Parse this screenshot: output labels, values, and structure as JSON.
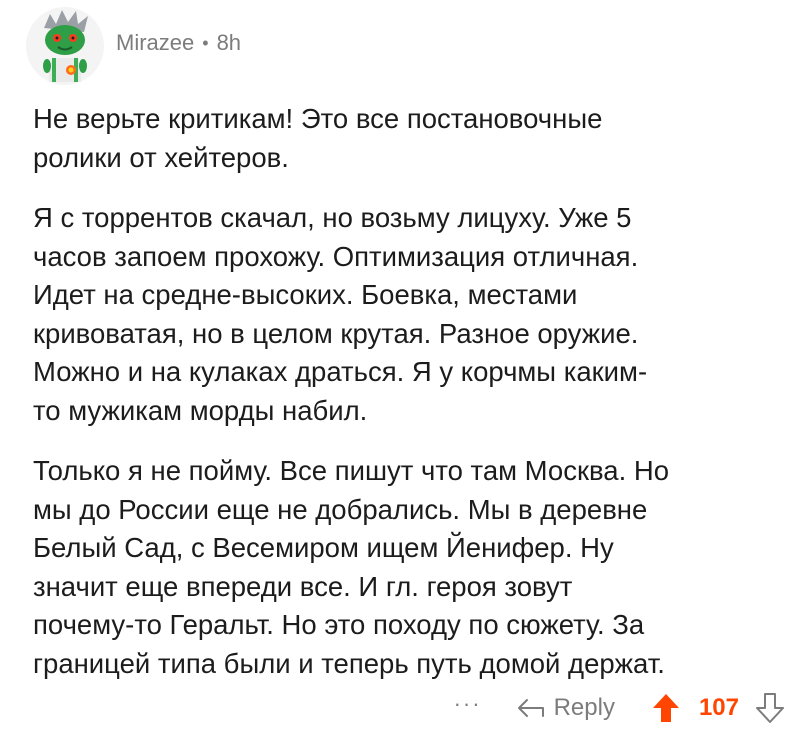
{
  "comment": {
    "author": "Mirazee",
    "separator": "•",
    "age": "8h",
    "paragraphs": [
      "Не верьте критикам! Это все постановочные\nролики от хейтеров.",
      "Я с торрентов скачал, но возьму лицуху. Уже 5\nчасов запоем прохожу. Оптимизация отличная.\nИдет на средне-высоких. Боевка, местами\nкривоватая, но в целом крутая. Разное оружие.\nМожно и на кулаках драться. Я у корчмы каким-\nто мужикам морды набил.",
      "Только я не пойму. Все пишут что там Москва. Но\nмы до России еще не добрались. Мы в деревне\nБелый Сад, с Весемиром ищем Йенифер. Ну\nзначит еще впереди все. И гл. героя зовут\nпочему-то Геральт. Но это походу по сюжету. За\nграницей типа были и теперь путь домой держат."
    ]
  },
  "actions": {
    "more_label": "···",
    "reply_label": "Reply",
    "score": "107"
  },
  "colors": {
    "accent": "#ff4500",
    "muted": "#7c7c7c",
    "text": "#1c1c1c"
  },
  "icons": {
    "avatar": "snoo-avatar-icon",
    "reply": "reply-arrow-icon",
    "upvote": "upvote-arrow-icon",
    "downvote": "downvote-arrow-icon"
  }
}
